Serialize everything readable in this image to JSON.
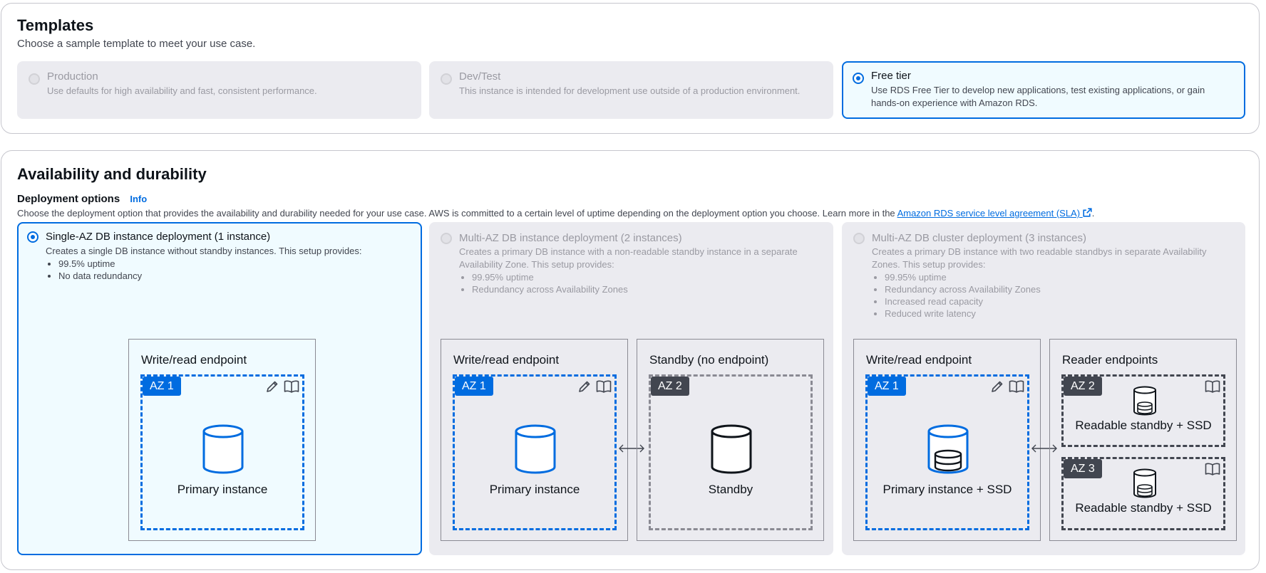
{
  "templates": {
    "title": "Templates",
    "description": "Choose a sample template to meet your use case.",
    "options": [
      {
        "title": "Production",
        "description": "Use defaults for high availability and fast, consistent performance.",
        "selected": false
      },
      {
        "title": "Dev/Test",
        "description": "This instance is intended for development use outside of a production environment.",
        "selected": false
      },
      {
        "title": "Free tier",
        "description": "Use RDS Free Tier to develop new applications, test existing applications, or gain hands-on experience with Amazon RDS.",
        "selected": true
      }
    ]
  },
  "availability": {
    "title": "Availability and durability",
    "deployment_label": "Deployment options",
    "info_link": "Info",
    "description_prefix": "Choose the deployment option that provides the availability and durability needed for your use case. AWS is committed to a certain level of uptime depending on the deployment option you choose. Learn more in the",
    "sla_link": "Amazon RDS service level agreement (SLA)",
    "description_suffix": ".",
    "options": [
      {
        "title": "Single-AZ DB instance deployment (1 instance)",
        "description": "Creates a single DB instance without standby instances. This setup provides:",
        "bullets": [
          "99.5% uptime",
          "No data redundancy"
        ],
        "selected": true,
        "diagram": {
          "box1_title": "Write/read endpoint",
          "az1": "AZ 1",
          "primary_caption": "Primary instance"
        }
      },
      {
        "title": "Multi-AZ DB instance deployment (2 instances)",
        "description": "Creates a primary DB instance with a non-readable standby instance in a separate Availability Zone. This setup provides:",
        "bullets": [
          "99.95% uptime",
          "Redundancy across Availability Zones"
        ],
        "selected": false,
        "diagram": {
          "box1_title": "Write/read endpoint",
          "box2_title": "Standby (no endpoint)",
          "az1": "AZ 1",
          "az2": "AZ 2",
          "primary_caption": "Primary instance",
          "standby_caption": "Standby"
        }
      },
      {
        "title": "Multi-AZ DB cluster deployment (3 instances)",
        "description": "Creates a primary DB instance with two readable standbys in separate Availability Zones. This setup provides:",
        "bullets": [
          "99.95% uptime",
          "Redundancy across Availability Zones",
          "Increased read capacity",
          "Reduced write latency"
        ],
        "selected": false,
        "diagram": {
          "box1_title": "Write/read endpoint",
          "box2_title": "Reader endpoints",
          "az1": "AZ 1",
          "az2": "AZ 2",
          "az3": "AZ 3",
          "primary_caption": "Primary instance + SSD",
          "reader1_caption": "Readable standby + SSD",
          "reader2_caption": "Readable standby + SSD"
        }
      }
    ]
  },
  "colors": {
    "accent": "#006ce0",
    "selected_bg": "#f0fbff",
    "disabled_bg": "#ebebf0"
  }
}
